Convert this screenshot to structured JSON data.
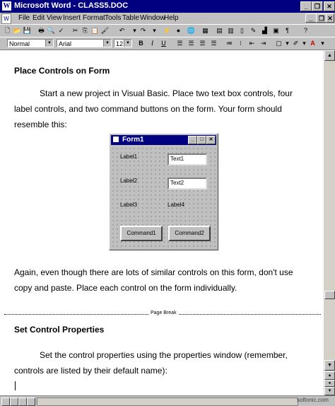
{
  "window": {
    "title": "Microsoft Word - CLASS5.DOC",
    "app_icon": "W",
    "minimize": "_",
    "restore": "❐",
    "close": "✕"
  },
  "menu": [
    "File",
    "Edit",
    "View",
    "Insert",
    "Format",
    "Tools",
    "Table",
    "Window",
    "Help"
  ],
  "formatting": {
    "style": "Normal",
    "font": "Arial",
    "size": "12",
    "bold": "B",
    "italic": "I",
    "underline": "U"
  },
  "document": {
    "heading1": "Place Controls on Form",
    "para1": "Start a new project in Visual Basic.  Place two text box controls, four label controls, and two command buttons on the form.  Your form should resemble this:",
    "para2": "Again, even though there are lots of similar controls on this form, don't use copy and paste.  Place each control on the form individually.",
    "page_break": "Page Break",
    "heading2": "Set Control Properties",
    "para3": "Set the control properties using the properties window (remember, controls are listed by their default name):"
  },
  "form_image": {
    "title": "Form1",
    "label1": "Label1",
    "label2": "Label2",
    "label3": "Label3",
    "label4": "Label4",
    "text1": "Text1",
    "text2": "Text2",
    "command1": "Command1",
    "command2": "Command2"
  },
  "watermark": "softonic.com",
  "colors": {
    "titlebar": "#000080",
    "chrome": "#c0c0c0",
    "page": "#ffffff"
  }
}
